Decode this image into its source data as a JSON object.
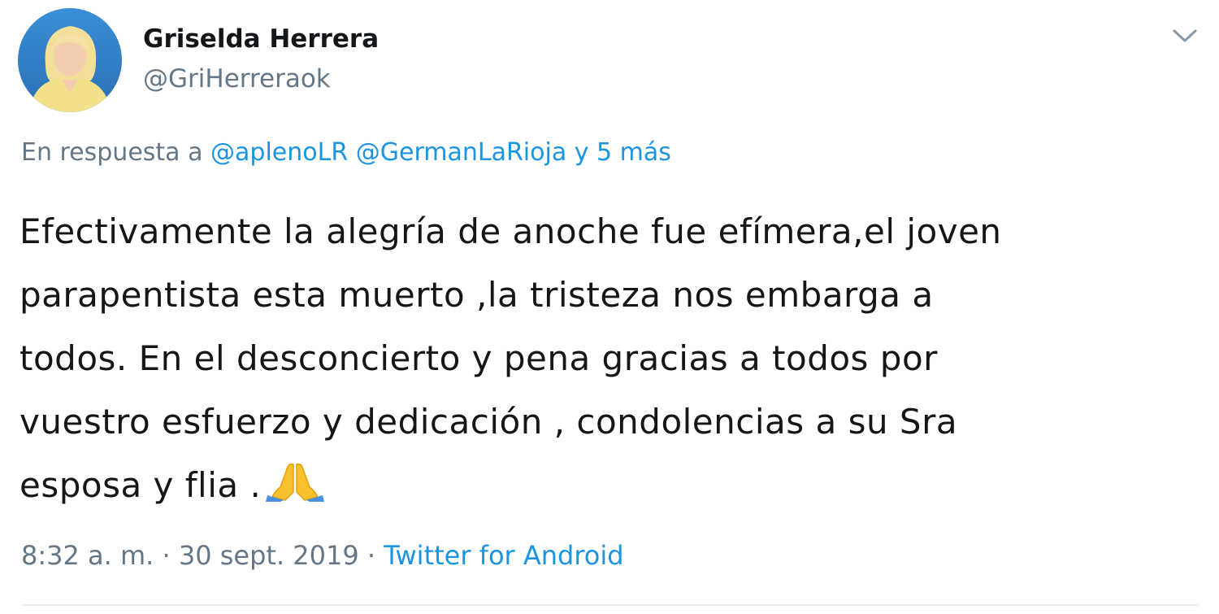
{
  "author": {
    "name": "Griselda Herrera",
    "handle": "@GriHerreraok"
  },
  "reply": {
    "prefix": "En respuesta a",
    "mentions": [
      "@aplenoLR",
      "@GermanLaRioja"
    ],
    "more": "y 5 más"
  },
  "tweet": {
    "lines": [
      "Efectivamente la alegría de anoche fue efímera,el joven",
      "parapentista esta muerto ,la tristeza nos embarga a",
      "todos. En el desconcierto y pena gracias a todos por",
      "vuestro esfuerzo y dedicación , condolencias a su Sra",
      "esposa y flia ."
    ],
    "emoji": "folded-hands-icon"
  },
  "meta": {
    "time": "8:32 a. m.",
    "separator": "·",
    "date": "30 sept. 2019",
    "source": "Twitter for Android"
  },
  "colors": {
    "text": "#14171a",
    "muted": "#657786",
    "link": "#1b95e0",
    "divider": "#e6ecf0"
  }
}
